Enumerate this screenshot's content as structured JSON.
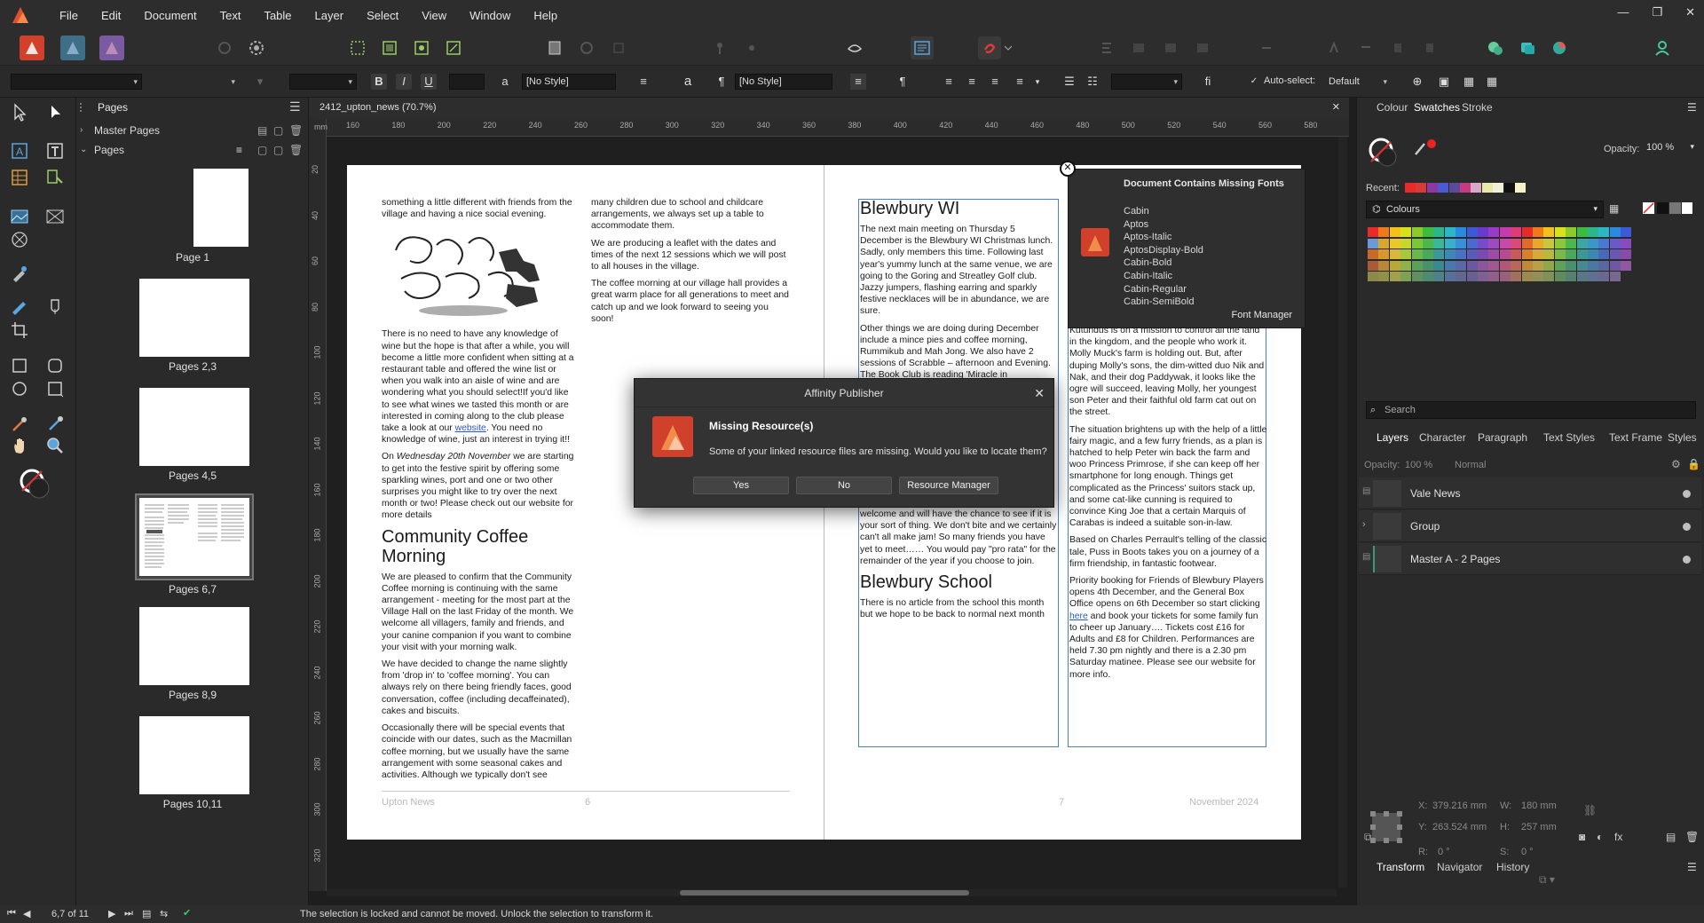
{
  "app": {
    "menu": [
      "File",
      "Edit",
      "Document",
      "Text",
      "Table",
      "Layer",
      "Select",
      "View",
      "Window",
      "Help"
    ],
    "window_controls": {
      "minimize": "—",
      "restore": "❐",
      "close": "✕"
    }
  },
  "context_toolbar": {
    "char_style": "[No Style]",
    "para_style": "[No Style]",
    "auto_select_label": "Auto-select:",
    "auto_select_value": "Default",
    "bold": "B",
    "italic": "I",
    "underline": "U"
  },
  "pages_panel": {
    "tab": "Pages",
    "master_pages": "Master Pages",
    "pages_header": "Pages",
    "pages": [
      {
        "label": "Page 1"
      },
      {
        "label": "Pages 2,3"
      },
      {
        "label": "Pages 4,5"
      },
      {
        "label": "Pages 6,7",
        "selected": true
      },
      {
        "label": "Pages 8,9"
      },
      {
        "label": "Pages 10,11"
      }
    ]
  },
  "document": {
    "tab_title": "2412_upton_news (70.7%)",
    "ruler_unit": "mm",
    "hruler": [
      "160",
      "180",
      "200",
      "220",
      "240",
      "260",
      "280",
      "300",
      "320",
      "340",
      "360",
      "380",
      "400",
      "420",
      "440",
      "460",
      "480",
      "500",
      "520",
      "540",
      "560",
      "580"
    ],
    "vruler": [
      "20",
      "40",
      "60",
      "80",
      "100",
      "120",
      "140",
      "160",
      "180",
      "200",
      "220",
      "240",
      "260",
      "280",
      "300",
      "320"
    ],
    "left_page": {
      "col1_top": "something a little different with friends from the village and having a nice social evening.",
      "col1_p2": "There is no need to have any knowledge of wine but the hope is that after a while, you will become a little more confident when sitting at a restaurant table and offered the wine list or when you walk into an aisle of wine and are wondering what you should select!If you'd like to see what wines we tasted this month or are interested in coming along to the club please take a look at our",
      "col1_p2_link": "website",
      "col1_p2_end": ".  You need no knowledge of wine, just an interest in trying it!!",
      "col1_p3_a": "On ",
      "col1_p3_em": "Wednesday 20th November",
      "col1_p3_b": " we are starting to get into the festive spirit by offering some sparkling wines, port and one or two other surprises you might like to try over the next month or two! Please check out our website for more details",
      "coffee_head": "Community Coffee Morning",
      "coffee_p1": "We are pleased to confirm that the Community Coffee morning is continuing with the same arrangement - meeting for the most part at the Village Hall on the last Friday of the month. We welcome all villagers, family and friends, and your canine companion if you want to combine your visit with your morning walk.",
      "coffee_p2": "We have decided to change the name slightly from 'drop in' to 'coffee morning'. You can always rely on there being friendly faces, good conversation, coffee (including decaffeinated), cakes and biscuits.",
      "coffee_p3": "Occasionally there will be special events that coincide with our dates, such as the Macmillan coffee morning, but we usually have the same arrangement with some seasonal cakes and activities. Although we typically don't see",
      "col2_p1": "many children due to school and childcare arrangements, we always set up a table to accommodate them.",
      "col2_p2": "We are producing a leaflet with the dates and times of the next 12 sessions which we will post to all houses in the village.",
      "col2_p3": "The coffee morning at our village hall provides a great warm place for all generations to meet and catch up and we look forward to seeing you soon!",
      "footer_left": "Upton News",
      "footer_num": "6"
    },
    "right_page": {
      "wi_head": "Blewbury WI",
      "wi_p1": "The next main meeting on Thursday 5 December is the Blewbury WI Christmas lunch.  Sadly, only members this time. Following last year's yummy lunch at the same venue, we are going to the Goring and Streatley Golf club. Jazzy jumpers, flashing earring and sparkly festive necklaces will be in abundance, we are sure.",
      "wi_p2": "Other things we are doing during December include a mince pies and coffee morning, Rummikub and Mah Jong.  We also have 2 sessions of Scrabble – afternoon and Evening.  The Book Club is reading 'Miracle in",
      "wi_p3": "welcome and will have the chance to see if it is your sort of thing. We don't bite and we certainly can't all make jam!  So many friends you have yet to meet…… You would pay \"pro rata\" for the remainder of the year if you choose to join.",
      "school_head": "Blewbury School",
      "school_p": "There is no article from the school this month but we hope to be back to normal next month",
      "col2_p1": "Kutundus is on a mission to control all the land in the kingdom, and the people who work it. Molly Muck's farm is holding out. But, after duping Molly's sons, the dim-witted duo Nik and Nak, and their dog Paddywak, it looks like the ogre will succeed, leaving Molly, her youngest son Peter and their faithful old farm cat out on the street.",
      "col2_p2": "The situation brightens up with the help of a little fairy magic, and a few furry friends, as a plan is hatched to help Peter win back the farm and woo Princess Primrose, if she can keep off her smartphone for long enough. Things get complicated as the Princess' suitors stack up, and some cat-like cunning is required to convince King Joe that a certain Marquis of Carabas is indeed a suitable son-in-law.",
      "col2_p3": "Based on Charles Perrault's telling of the classic tale, Puss in Boots takes you on a journey of a firm friendship, in fantastic footwear.",
      "col2_p4_a": "Priority booking for Friends of Blewbury Players opens 4th December, and the General Box Office opens on 6th December so start clicking ",
      "col2_p4_link": "here",
      "col2_p4_b": "  and book your tickets for some family fun to cheer up January…. Tickets cost £16 for Adults and £8 for Children. Performances are held 7.30 pm nightly and there is a 2.30 pm Saturday matinee. Please see our website for more info.",
      "footer_num": "7",
      "footer_right": "November 2024"
    }
  },
  "missing_fonts": {
    "title": "Document Contains Missing Fonts",
    "fonts": [
      "Cabin",
      "Aptos",
      "Aptos-Italic",
      "AptosDisplay-Bold",
      "Cabin-Bold",
      "Cabin-Italic",
      "Cabin-Regular",
      "Cabin-SemiBold"
    ],
    "button": "Font Manager"
  },
  "dialog": {
    "title": "Affinity Publisher",
    "heading": "Missing Resource(s)",
    "message": "Some of your linked resource files are missing. Would you like to locate them?",
    "yes": "Yes",
    "no": "No",
    "manager": "Resource Manager"
  },
  "right_panel": {
    "tabs_top": [
      "Colour",
      "Swatches",
      "Stroke"
    ],
    "active_top": "Swatches",
    "opacity_label": "Opacity:",
    "opacity_value": "100 %",
    "recent_label": "Recent:",
    "palette": "Colours",
    "search_placeholder": "Search",
    "tabs_mid": [
      "Layers",
      "Character",
      "Paragraph",
      "Text Styles",
      "Text Frame",
      "Styles"
    ],
    "layer_opacity_label": "Opacity:",
    "layer_opacity": "100 %",
    "blend": "Normal",
    "layers": [
      "Vale News",
      "Group",
      "Master A - 2 Pages"
    ],
    "tabs_bottom": [
      "Transform",
      "Navigator",
      "History"
    ],
    "transform": {
      "x_label": "X:",
      "x": "379.216 mm",
      "y_label": "Y:",
      "y": "263.524 mm",
      "w_label": "W:",
      "w": "180 mm",
      "h_label": "H:",
      "h": "257 mm",
      "r_label": "R:",
      "r": "0 °",
      "s_label": "S:",
      "s": "0 °"
    }
  },
  "status": {
    "page_indicator": "6,7 of 11",
    "message": "The selection is locked and cannot be moved. Unlock the selection to transform it."
  },
  "colors": {
    "accent": "#d0402a",
    "link": "#2a56c6",
    "selection": "#4a7fd0"
  }
}
